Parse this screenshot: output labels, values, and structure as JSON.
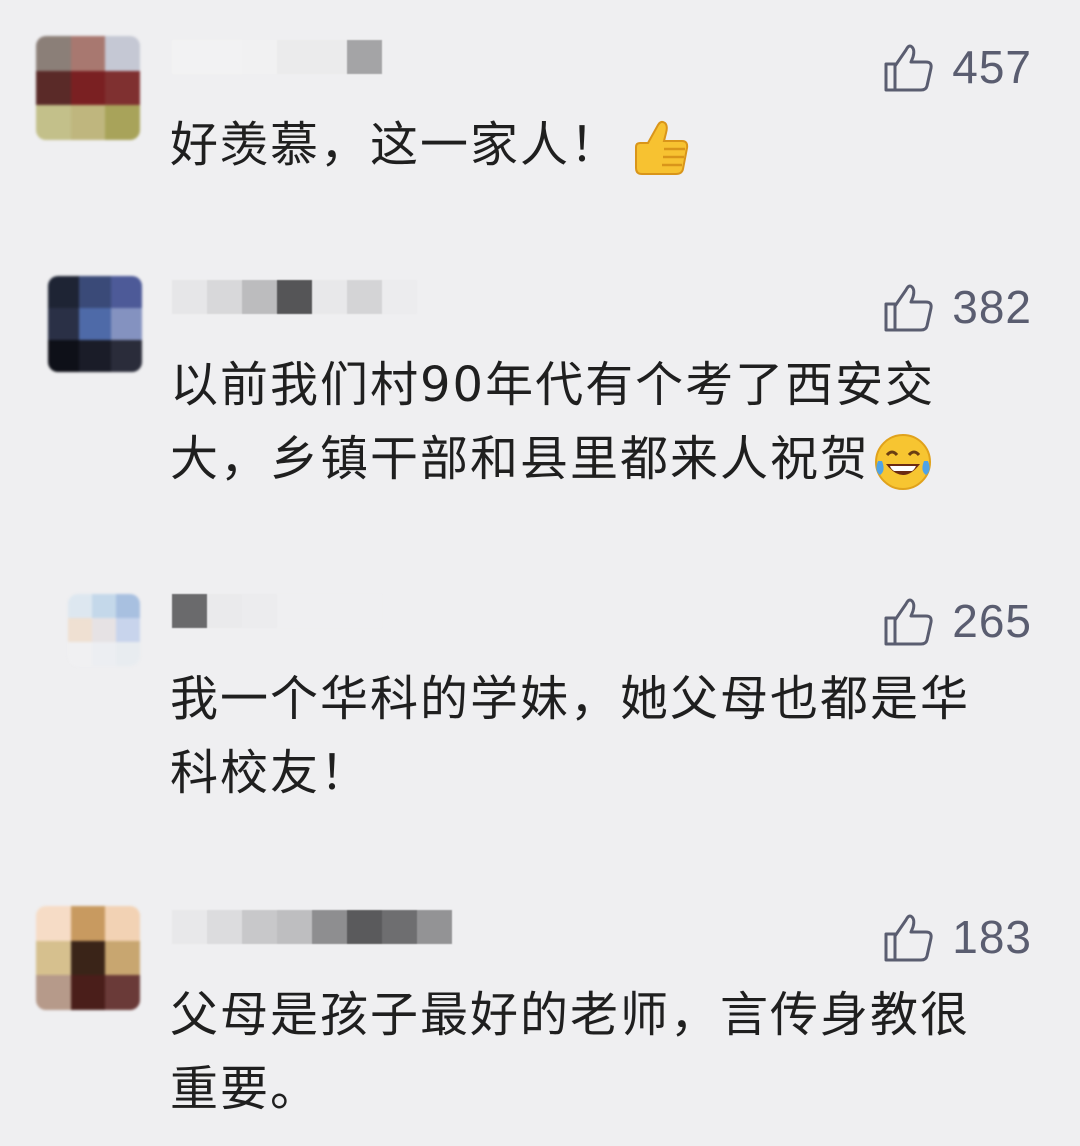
{
  "comments": [
    {
      "likes": "457",
      "text": "好羡慕，这一家人！",
      "emoji": "thumbs-up-emoji",
      "avatar_colors": [
        "#8b7f78",
        "#a87870",
        "#c5c8d4",
        "#5a2a28",
        "#7a2022",
        "#7f3030",
        "#c3c08a",
        "#bfb67e",
        "#a8a35a"
      ],
      "name_colors": [
        "#f2f2f3",
        "#f2f2f3",
        "#f1f1f2",
        "#ebebec",
        "#ebebec",
        "#a4a4a6"
      ]
    },
    {
      "likes": "382",
      "text": "以前我们村90年代有个考了西安交大，乡镇干部和县里都来人祝贺",
      "emoji": "tears-of-joy-emoji",
      "avatar_colors": [
        "#1e2434",
        "#3a4a78",
        "#4d5a98",
        "#2a3046",
        "#4e6aa8",
        "#8492c0",
        "#0e1018",
        "#1a1c28",
        "#2a2c3a"
      ],
      "name_colors": [
        "#e6e6e8",
        "#d8d8da",
        "#bcbcbe",
        "#555557",
        "#e8e8ea",
        "#d4d4d6",
        "#ececee"
      ]
    },
    {
      "likes": "265",
      "text": "我一个华科的学妹，她父母也都是华科校友！",
      "emoji": "",
      "avatar_colors": [
        "#dde7f0",
        "#c4d8ea",
        "#a8c0e0",
        "#efe0d2",
        "#e6e2e4",
        "#c8d4ec",
        "#f0f0f2",
        "#eceef2",
        "#e8ecf0"
      ],
      "name_colors": [
        "#6a6a6c",
        "#eaeaec",
        "#ececee",
        "#efeff1",
        "#efeff1",
        "#efeff1"
      ]
    },
    {
      "likes": "183",
      "text": "父母是孩子最好的老师，言传身教很重要。",
      "emoji": "",
      "avatar_colors": [
        "#f6dcc6",
        "#c89a60",
        "#f2d2b4",
        "#d6c08e",
        "#3a2418",
        "#c8a670",
        "#b69a8a",
        "#4a1e1a",
        "#6a3a38"
      ],
      "name_colors": [
        "#e8e8ea",
        "#dcdcde",
        "#c8c8ca",
        "#bebec0",
        "#8e8e90",
        "#5a5a5c",
        "#6e6e70",
        "#939395"
      ]
    }
  ]
}
